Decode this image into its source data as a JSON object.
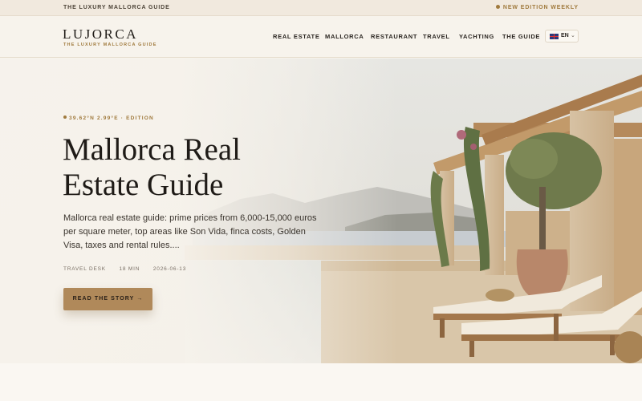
{
  "topbar": {
    "left_text": "THE LUXURY MALLORCA GUIDE",
    "right_text": "NEW EDITION WEEKLY"
  },
  "header": {
    "logo": "LUJORCA",
    "tagline": "THE LUXURY MALLORCA GUIDE",
    "nav": [
      "REAL ESTATE",
      "MALLORCA",
      "RESTAURANT",
      "TRAVEL",
      "YACHTING",
      "THE GUIDE"
    ],
    "language": {
      "code": "EN",
      "flag": "uk-flag-icon"
    }
  },
  "hero": {
    "edition": "39.62°N 2.99°E · EDITION",
    "title_line1": "Mallorca Real",
    "title_line2": "Estate Guide",
    "description": "Mallorca real estate guide: prime prices from 6,000-15,000 euros per square meter, top areas like Son Vida, finca costs, Golden Visa, taxes and rental rules....",
    "meta": {
      "author": "TRAVEL DESK",
      "read_time": "18 MIN",
      "date": "2026-06-13"
    },
    "cta_label": "READ THE STORY →"
  },
  "colors": {
    "accent": "#a07a3d",
    "button": "#b0895a",
    "background": "#f7f3ec",
    "text": "#1f1b17"
  }
}
